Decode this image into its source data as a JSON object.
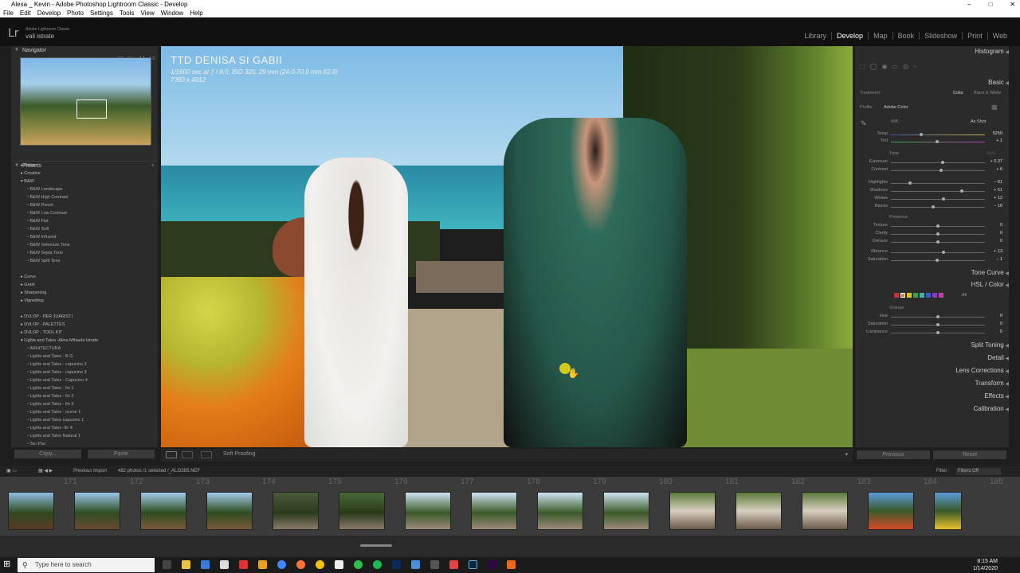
{
  "window": {
    "title": "Alexa _ Kevin - Adobe Photoshop Lightroom Classic - Develop"
  },
  "menu": [
    "File",
    "Edit",
    "Develop",
    "Photo",
    "Settings",
    "Tools",
    "View",
    "Window",
    "Help"
  ],
  "identity": {
    "logo": "Lr",
    "product": "Adobe Lightroom Classic",
    "user": "vali istrate"
  },
  "modules": [
    "Library",
    "Develop",
    "Map",
    "Book",
    "Slideshow",
    "Print",
    "Web"
  ],
  "active_module": "Develop",
  "left": {
    "navigator": {
      "label": "Navigator",
      "zoom": [
        "FIT",
        "FILL",
        "1:1",
        "1:3"
      ]
    },
    "presets": {
      "label": "Presets",
      "groups": [
        "Color",
        "Creative",
        "B&W"
      ],
      "bw_items": [
        "B&W Landscape",
        "B&W High Contrast",
        "B&W Punch",
        "B&W Low Contrast",
        "B&W Flat",
        "B&W Soft",
        "B&W Infrared",
        "B&W Selenium Tone",
        "B&W Sepia Tone",
        "B&W Split Tone"
      ],
      "groups2": [
        "Curve",
        "Grain",
        "Sharpening",
        "Vignetting"
      ],
      "groups3": [
        "DVLOP - PER JUARISTI",
        "DVLOP - PALETTES",
        "DVLOP - TOOL KIT",
        "Lights and Tales -Alina Mihaela Istrate"
      ],
      "lt_items": [
        "ARHITECTURA",
        "Lights and Tales - B G",
        "Lights and Tales - capucino 2",
        "Lights and Tales - capucino 3",
        "Lights and Tales - Capucino 4",
        "Lights and Tales - fin 1",
        "Lights and Tales - fin 2",
        "Lights and Tales - fin 3",
        "Lights and Tales - scene 1",
        "Lights and Tales capucino 1",
        "Lights and Tales -fin 4",
        "Lights and Tales Natural  1",
        "Tac-Pac"
      ]
    },
    "copy": "Copy...",
    "paste": "Paste"
  },
  "photo": {
    "title": "TTD DENISA SI GABII",
    "exif": "1/1600 sec at ƒ / 8.0, ISO 320, 29 mm (24.0-70.0 mm f/2.8)",
    "dims": "7360 x 4912"
  },
  "toolbar": {
    "soft_proofing": "Soft Proofing"
  },
  "right": {
    "histogram": "Histogram",
    "basic": "Basic",
    "treatment_label": "Treatment :",
    "treatment_color": "Color",
    "treatment_bw": "Black & White",
    "profile_label": "Profile :",
    "profile_value": "Adobe Color",
    "wb_label": "WB :",
    "wb_value": "As Shot",
    "temp": {
      "label": "Temp",
      "value": "5250"
    },
    "tint": {
      "label": "Tint",
      "value": "+ 1"
    },
    "tone_label": "Tone",
    "tone_auto": "Auto",
    "sliders_tone": [
      {
        "label": "Exposure",
        "value": "+ 0.37",
        "pos": 0.55
      },
      {
        "label": "Contrast",
        "value": "+ 6",
        "pos": 0.53
      }
    ],
    "sliders_tone2": [
      {
        "label": "Highlights",
        "value": "− 61",
        "pos": 0.2
      },
      {
        "label": "Shadows",
        "value": "+ 51",
        "pos": 0.75
      },
      {
        "label": "Whites",
        "value": "+ 12",
        "pos": 0.56
      },
      {
        "label": "Blacks",
        "value": "− 10",
        "pos": 0.45
      }
    ],
    "presence_label": "Presence",
    "sliders_presence": [
      {
        "label": "Texture",
        "value": "0",
        "pos": 0.5
      },
      {
        "label": "Clarity",
        "value": "0",
        "pos": 0.5
      },
      {
        "label": "Dehaze",
        "value": "0",
        "pos": 0.5
      }
    ],
    "sliders_presence2": [
      {
        "label": "Vibrance",
        "value": "+ 13",
        "pos": 0.56
      },
      {
        "label": "Saturation",
        "value": "− 1",
        "pos": 0.49
      }
    ],
    "tone_curve": "Tone Curve",
    "hsl": "HSL / Color",
    "hsl_all": "All",
    "hsl_color": "Orange",
    "sliders_hsl": [
      {
        "label": "Hue",
        "value": "0",
        "pos": 0.5
      },
      {
        "label": "Saturation",
        "value": "0",
        "pos": 0.5
      },
      {
        "label": "Luminance",
        "value": "0",
        "pos": 0.5
      }
    ],
    "sections": [
      "Split Toning",
      "Detail",
      "Lens Corrections",
      "Transform",
      "Effects",
      "Calibration"
    ],
    "previous": "Previous",
    "reset": "Reset"
  },
  "filmstrip": {
    "source": "Previous Import",
    "count": "482 photos /1 selected /_ALI3385.NEF",
    "filter_label": "Filter :",
    "filter_value": "Filters Off",
    "numbers": [
      "171",
      "172",
      "173",
      "174",
      "175",
      "176",
      "177",
      "178",
      "179",
      "180",
      "181",
      "182",
      "183",
      "184",
      "185"
    ]
  },
  "taskbar": {
    "search": "Type here to search",
    "time": "8:15 AM",
    "date": "1/14/2020"
  }
}
